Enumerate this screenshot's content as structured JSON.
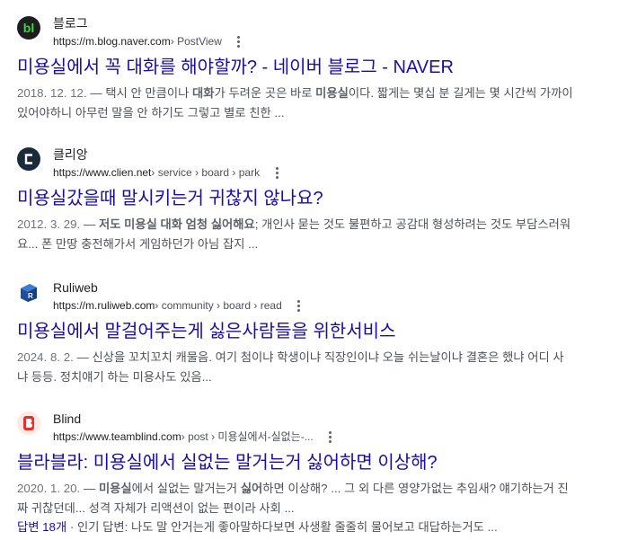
{
  "results": [
    {
      "site_name": "블로그",
      "url": "https://m.blog.naver.com",
      "path": " › PostView",
      "favicon_text": "bl",
      "title": "미용실에서 꼭 대화를 해야할까? - 네이버 블로그 - NAVER",
      "date": "2018. 12. 12.",
      "snippet_line1_a": " — 택시 안 만큼이나 ",
      "snippet_line1_b1": "대화",
      "snippet_line1_c": "가 두려운 곳은 바로 ",
      "snippet_line1_b2": "미용실",
      "snippet_line1_d": "이다. 짧게는 몇십 분 길게는 몇 시간씩 가까이",
      "snippet_line2": "있어야하니 아무런 말을 안 하기도 그렇고 별로 친한 ..."
    },
    {
      "site_name": "클리앙",
      "url": "https://www.clien.net",
      "path": " › service › board › park",
      "favicon_text": "C",
      "title": "미용실갔을때 말시키는거 귀찮지 않나요?",
      "date": "2012. 3. 29.",
      "snippet_line1_a": " — ",
      "snippet_line1_b1": "저도 미용실 대화 엄청 싫어해요",
      "snippet_line1_c": "; 개인사 묻는 것도 불편하고 공감대 형성하려는 것도 부담스러워",
      "snippet_line2": "요... 폰 만땅 충전해가서 게임하던가 아님 잡지 ..."
    },
    {
      "site_name": "Ruliweb",
      "url": "https://m.ruliweb.com",
      "path": " › community › board › read",
      "title": "미용실에서 말걸어주는게 싫은사람들을 위한서비스",
      "date": "2024. 8. 2.",
      "snippet_line1_a": " — 신상을 꼬치꼬치 캐물음. 여기 첨이냐 학생이냐 직장인이냐 오늘 쉬는날이냐 결혼은 했냐 어디 사",
      "snippet_line2": "냐 등등. 정치얘기 하는 미용사도 있음..."
    },
    {
      "site_name": "Blind",
      "url": "https://www.teamblind.com",
      "path": " › post › 미용실에서-실없는-...",
      "title": "블라블라: 미용실에서 실없는 말거는거 싫어하면 이상해?",
      "date": "2020. 1. 20.",
      "snippet_line1_a": " — ",
      "snippet_line1_b1": "미용실",
      "snippet_line1_c": "에서 실없는 말거는거 ",
      "snippet_line1_b2": "싫어",
      "snippet_line1_d": "하면 이상해? ... 그 외 다른 영양가없는 추임새? 얘기하는거 진",
      "snippet_line2": "짜 귀찮던데... 성격 자체가 리액션이 없는 편이라 사회 ...",
      "answers_label": "답변 18개",
      "answers_rest": " · 인기 답변: 나도 말 안거는게 좋아말하다보면 사생활 줄줄히 물어보고 대답하는거도 ..."
    }
  ]
}
